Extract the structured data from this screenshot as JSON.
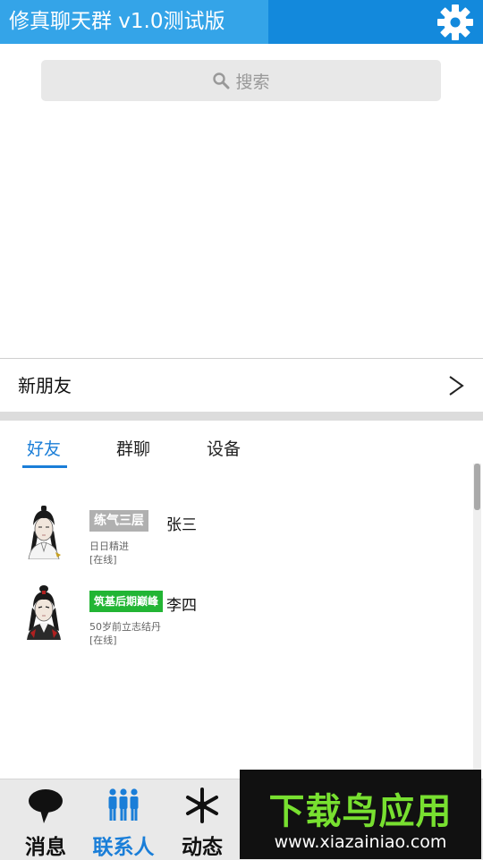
{
  "header": {
    "title": "修真聊天群 v1.0测试版",
    "settings_icon": "gear-icon"
  },
  "search": {
    "label": "搜索",
    "icon": "search-icon"
  },
  "new_friend": {
    "label": "新朋友",
    "arrow": ">"
  },
  "tabs": [
    {
      "label": "好友",
      "active": true
    },
    {
      "label": "群聊",
      "active": false
    },
    {
      "label": "设备",
      "active": false
    }
  ],
  "friends": [
    {
      "rank": "练气三层",
      "rank_color": "#b0b0b0",
      "name": "张三",
      "motto": "日日精进",
      "status": "[在线]"
    },
    {
      "rank": "筑基后期巅峰",
      "rank_color": "#22b534",
      "name": "李四",
      "motto": "50岁前立志结丹",
      "status": "[在线]"
    }
  ],
  "bottom_nav": [
    {
      "label": "消息",
      "icon": "chat-bubble-icon",
      "active": false
    },
    {
      "label": "联系人",
      "icon": "people-icon",
      "active": true
    },
    {
      "label": "动态",
      "icon": "snowflake-icon",
      "active": false
    }
  ],
  "watermark": {
    "logo": "下载鸟应用",
    "url": "www.xiazainiao.com"
  },
  "colors": {
    "header": "#1389dc",
    "title_bg": "#34a4e8",
    "accent": "#1a7ed8",
    "watermark_green": "#78e030"
  }
}
